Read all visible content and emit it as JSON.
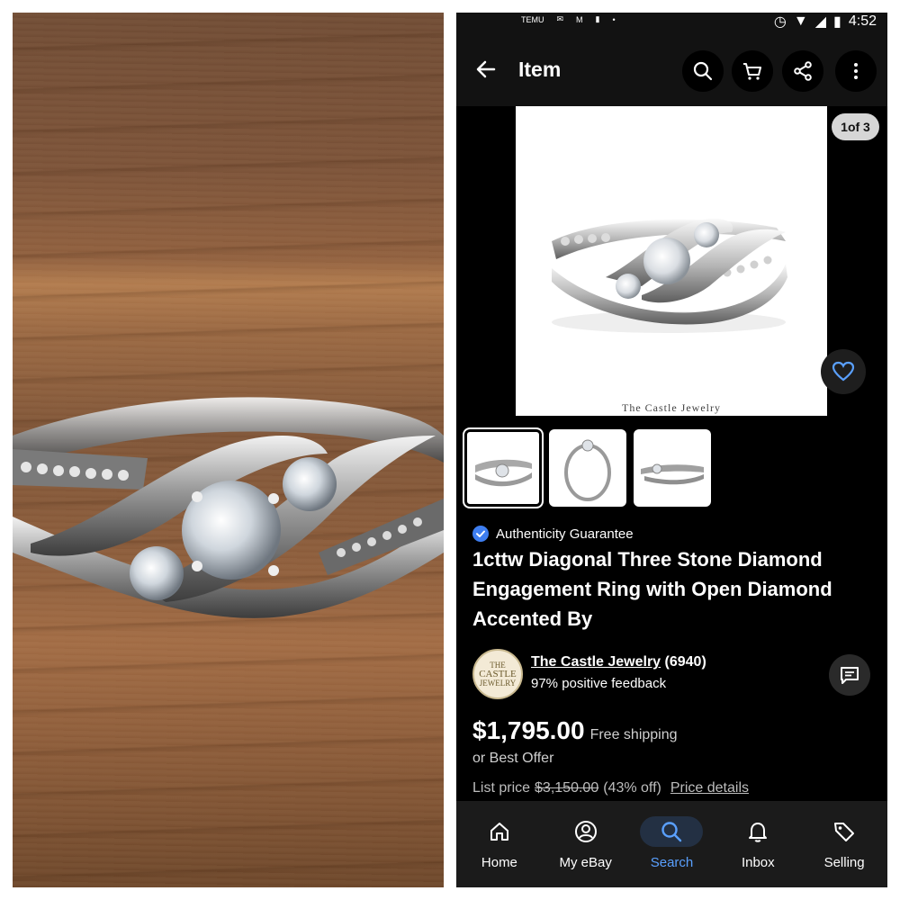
{
  "status_bar": {
    "left_icons": [
      "TEMU",
      "gmail-icon",
      "M",
      "phone-icon",
      "dot"
    ],
    "time": "4:52"
  },
  "app_bar": {
    "title": "Item"
  },
  "gallery": {
    "pager": "1of 3",
    "caption": "The Castle Jewelry",
    "thumbnail_count": 3
  },
  "item": {
    "authenticity": "Authenticity Guarantee",
    "title": "1cttw Diagonal Three Stone Diamond Engagement Ring with Open Diamond Accented By"
  },
  "seller": {
    "logo_text": [
      "THE",
      "CASTLE",
      "JEWELRY"
    ],
    "name": "The Castle Jewelry",
    "count": "(6940)",
    "feedback": "97% positive feedback"
  },
  "pricing": {
    "price": "$1,795.00",
    "shipping": "Free shipping",
    "best_offer": "or Best Offer",
    "list_label": "List price",
    "list_price": "$3,150.00",
    "discount": "(43% off)",
    "details_link": "Price details"
  },
  "bottom_nav": {
    "items": [
      {
        "label": "Home",
        "icon": "home-icon"
      },
      {
        "label": "My eBay",
        "icon": "user-icon"
      },
      {
        "label": "Search",
        "icon": "search-icon",
        "active": true
      },
      {
        "label": "Inbox",
        "icon": "bell-icon"
      },
      {
        "label": "Selling",
        "icon": "tag-icon"
      }
    ]
  },
  "colors": {
    "background": "#000000",
    "accent_blue": "#5aa0ff",
    "verified_blue": "#3e7ef0"
  }
}
